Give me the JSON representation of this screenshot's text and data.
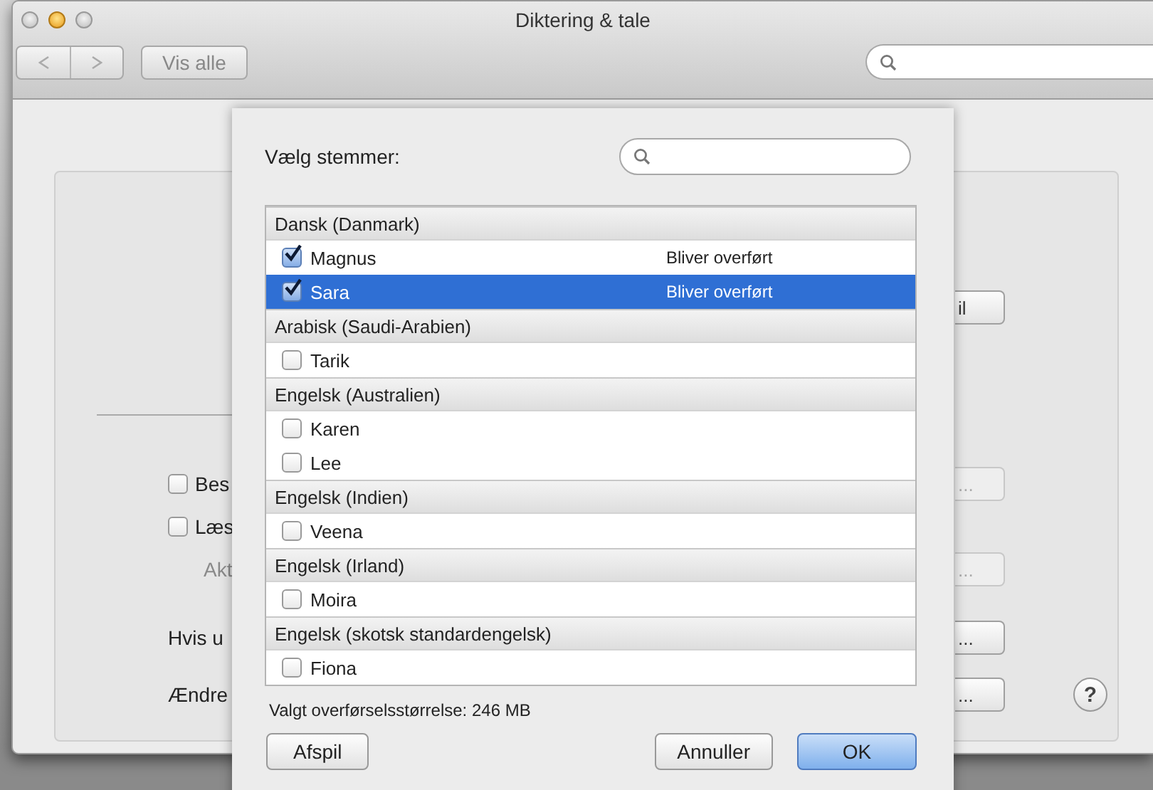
{
  "window": {
    "title": "Diktering & tale"
  },
  "toolbar": {
    "show_all": "Vis alle"
  },
  "background_rows": [
    {
      "kind": "button",
      "button": {
        "label": "il",
        "disabled": false
      }
    },
    {
      "kind": "checkbox",
      "label": "Bes",
      "checked": false,
      "disabled": false,
      "button": {
        "label": "...",
        "disabled": true
      }
    },
    {
      "kind": "checkbox",
      "label": "Læs",
      "checked": false,
      "disabled": false
    },
    {
      "kind": "text",
      "label": "Akt",
      "disabled": true,
      "button": {
        "label": "...",
        "disabled": true
      }
    },
    {
      "kind": "text",
      "label": "Hvis u",
      "disabled": false,
      "button": {
        "label": "...",
        "disabled": false
      }
    },
    {
      "kind": "text",
      "label": "Ændre",
      "disabled": false,
      "button": {
        "label": "...",
        "disabled": false
      },
      "help": "?"
    }
  ],
  "sheet": {
    "prompt": "Vælg stemmer:",
    "groups": [
      {
        "language": "Dansk (Danmark)",
        "voices": [
          {
            "name": "Magnus",
            "checked": true,
            "selected": false,
            "status": "Bliver overført"
          },
          {
            "name": "Sara",
            "checked": true,
            "selected": true,
            "status": "Bliver overført"
          }
        ]
      },
      {
        "language": "Arabisk (Saudi-Arabien)",
        "voices": [
          {
            "name": "Tarik",
            "checked": false,
            "selected": false
          }
        ]
      },
      {
        "language": "Engelsk (Australien)",
        "voices": [
          {
            "name": "Karen",
            "checked": false,
            "selected": false
          },
          {
            "name": "Lee",
            "checked": false,
            "selected": false
          }
        ]
      },
      {
        "language": "Engelsk (Indien)",
        "voices": [
          {
            "name": "Veena",
            "checked": false,
            "selected": false
          }
        ]
      },
      {
        "language": "Engelsk (Irland)",
        "voices": [
          {
            "name": "Moira",
            "checked": false,
            "selected": false
          }
        ]
      },
      {
        "language": "Engelsk (skotsk standardengelsk)",
        "voices": [
          {
            "name": "Fiona",
            "checked": false,
            "selected": false
          }
        ]
      }
    ],
    "download_size": "Valgt overførselsstørrelse: 246 MB",
    "buttons": [
      {
        "label": "Afspil",
        "kind": "normal"
      },
      {
        "label": "Annuller",
        "kind": "normal"
      },
      {
        "label": "OK",
        "kind": "default"
      }
    ]
  }
}
